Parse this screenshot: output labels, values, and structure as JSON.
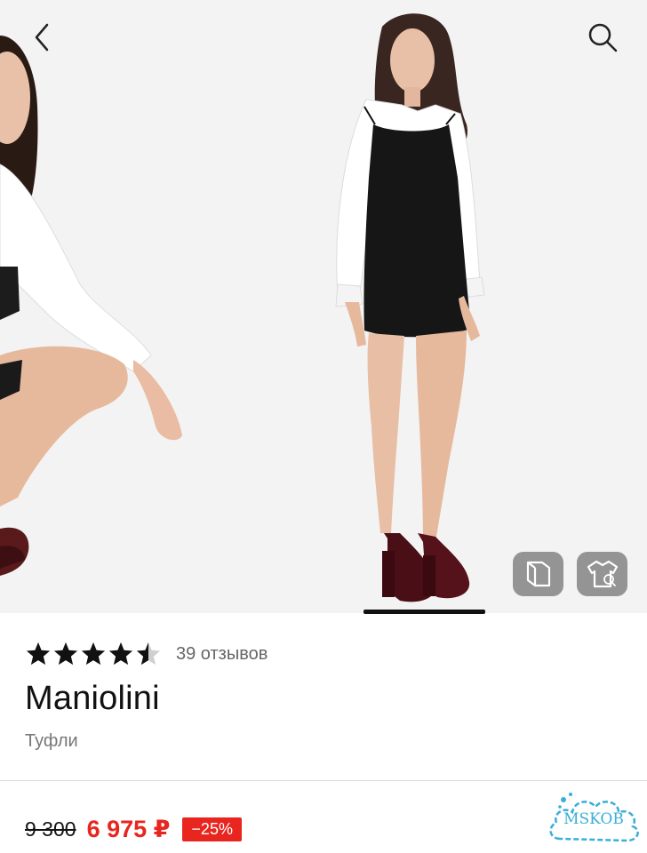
{
  "header": {
    "back_icon": "chevron-left-icon",
    "search_icon": "search-icon"
  },
  "gallery": {
    "overlay_buttons": [
      {
        "icon": "size-chart-icon"
      },
      {
        "icon": "try-on-shirt-icon"
      }
    ],
    "active_slide_indicator": "visible"
  },
  "product": {
    "rating": 4.5,
    "reviews_label": "39 отзывов",
    "brand": "Maniolini",
    "category": "Туфли"
  },
  "price": {
    "old": "9 300",
    "current": "6 975 ₽",
    "discount": "−25%"
  },
  "watermark": {
    "text": "MSKOB"
  },
  "colors": {
    "accent_red": "#e8261f",
    "watermark_blue": "#3aaed8",
    "overlay_grey": "#787878"
  }
}
